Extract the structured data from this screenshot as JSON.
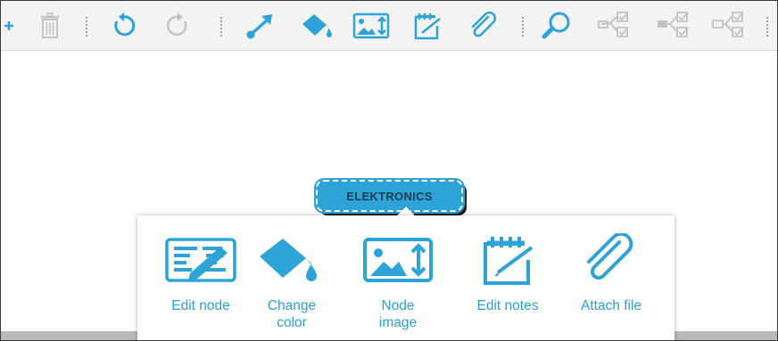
{
  "node": {
    "title": "ELEKTRONICS"
  },
  "toolbar": {
    "icons": [
      "add-icon",
      "trash-icon",
      "undo-icon",
      "redo-icon",
      "connect-arrow-icon",
      "fill-color-icon",
      "image-icon",
      "notes-icon",
      "attachment-icon",
      "search-icon",
      "checklist-icon",
      "checklist-filled-icon",
      "checklist-outline-icon"
    ]
  },
  "popup": {
    "actions": [
      {
        "label": "Edit node",
        "icon": "edit-node-icon"
      },
      {
        "label": "Change\ncolor",
        "icon": "fill-color-icon"
      },
      {
        "label": "Node\nimage",
        "icon": "node-image-icon"
      },
      {
        "label": "Edit notes",
        "icon": "notes-icon"
      },
      {
        "label": "Attach file",
        "icon": "attachment-icon"
      }
    ]
  },
  "colors": {
    "accent": "#2ea3d8",
    "toolbar_bg": "#f3f3f3",
    "inactive_icon": "#c4c4c4"
  }
}
